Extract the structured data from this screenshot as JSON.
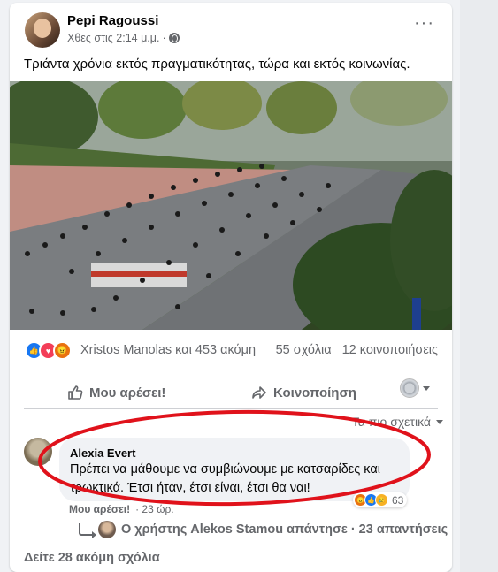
{
  "post": {
    "author": "Pepi Ragoussi",
    "timestamp": "Χθες στις 2:14 μ.μ.",
    "separator": "·",
    "text": "Τριάντα χρόνια εκτός πραγματικότητας,  τώρα και εκτός κοινωνίας."
  },
  "reactions": {
    "icons": [
      "like-icon",
      "love-icon",
      "angry-icon"
    ],
    "names": "Xristos Manolas και 453 ακόμη",
    "comments": "55 σχόλια",
    "shares": "12 κοινοποιήσεις"
  },
  "actions": {
    "like": "Μου αρέσει!",
    "share": "Κοινοποίηση"
  },
  "comments": {
    "sort_label": "Τα πιο σχετικά",
    "top_comment": {
      "author": "Alexia Evert",
      "text": "Πρέπει να μάθουμε να συμβιώνουμε με κατσαρίδες και τρωκτικά. Έτσι ήταν, έτσι είναι, έτσι θα ναι!",
      "reaction_count": "63",
      "like_label": "Μου αρέσει!",
      "time": "· 23 ώρ."
    },
    "replies": "Ο χρήστης Alekos Stamou απάντησε · 23 απαντήσεις",
    "more": "Δείτε 28 ακόμη σχόλια"
  },
  "colors": {
    "highlight": "#e0121b",
    "like_blue": "#1877f2",
    "secondary_text": "#65676b"
  }
}
